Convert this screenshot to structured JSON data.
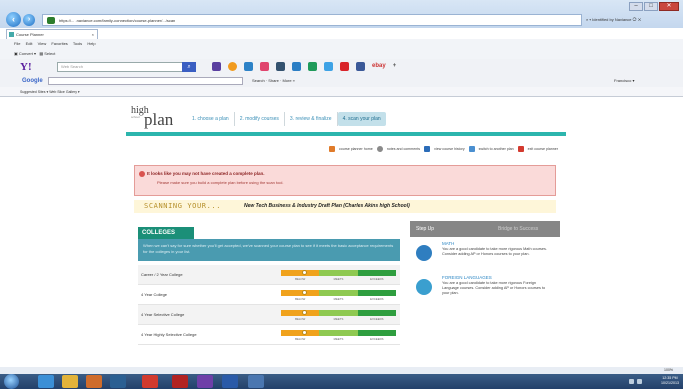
{
  "browser": {
    "url": "https://... .naviance.com/family-connection/course-planner/.../scan",
    "identity": "Identified by Naviance",
    "tab_title": "Course Planner",
    "menu": [
      "File",
      "Edit",
      "View",
      "Favorites",
      "Tools",
      "Help"
    ],
    "command": [
      "Convert",
      "Select"
    ],
    "yahoo_search_placeholder": "Web Search",
    "google_label": "Google",
    "google_tools": "Search  ·  Share  ·  More »",
    "google_right": "Francisco ▾",
    "favorites": "Suggested Sites ▾   Web Slice Gallery ▾",
    "status_zoom": "100%",
    "colors": {
      "chrome": "#c4d7ee",
      "taskbar": "#23406a"
    }
  },
  "page": {
    "logo": {
      "high": "high",
      "school": "school",
      "plan": "plan"
    },
    "steps": [
      {
        "label": "1. choose a plan"
      },
      {
        "label": "2. modify courses"
      },
      {
        "label": "3. review & finalize"
      },
      {
        "label": "4. scan your plan"
      }
    ],
    "links": [
      {
        "label": "course planner home"
      },
      {
        "label": "notes and comments"
      },
      {
        "label": "view course history"
      },
      {
        "label": "switch to another plan"
      },
      {
        "label": "exit course planner"
      }
    ],
    "alert": {
      "title": "It looks like you may not have created a complete plan.",
      "subtitle": "Please make sure you build a complete plan before using the scan tool."
    },
    "scan": {
      "heading": "SCANNING YOUR...",
      "plan_name": "New Tech Business & Industry Draft Plan (Charles Akins high School)"
    },
    "colleges": {
      "heading": "COLLEGES",
      "description": "When we can't say for sure whether you'll get accepted, we've scanned your course plan to see if it meets the basic acceptance requirements for the colleges in your list.",
      "scale_labels": [
        "BELOW",
        "MEETS",
        "EXCEEDS"
      ],
      "rows": [
        {
          "label": "Career / 2 Year College",
          "level": 0.2
        },
        {
          "label": "4 Year College",
          "level": 0.2
        },
        {
          "label": "4 Year Selective College",
          "level": 0.2
        },
        {
          "label": "4 Year Highly Selective College",
          "level": 0.2
        }
      ]
    },
    "sidebar": {
      "step_up": "Step Up",
      "bridge": "Bridge to Success",
      "items": [
        {
          "title": "MATH",
          "text": "You are a good candidate to take more rigorous Math courses. Consider adding AP or Honors courses to your plan."
        },
        {
          "title": "FOREIGN LANGUAGES",
          "text": "You are a good candidate to take more rigorous Foreign Language courses. Consider adding AP or Honors courses to your plan."
        }
      ]
    }
  },
  "taskbar": {
    "time": "12:35 PM",
    "date": "10/21/2013"
  }
}
